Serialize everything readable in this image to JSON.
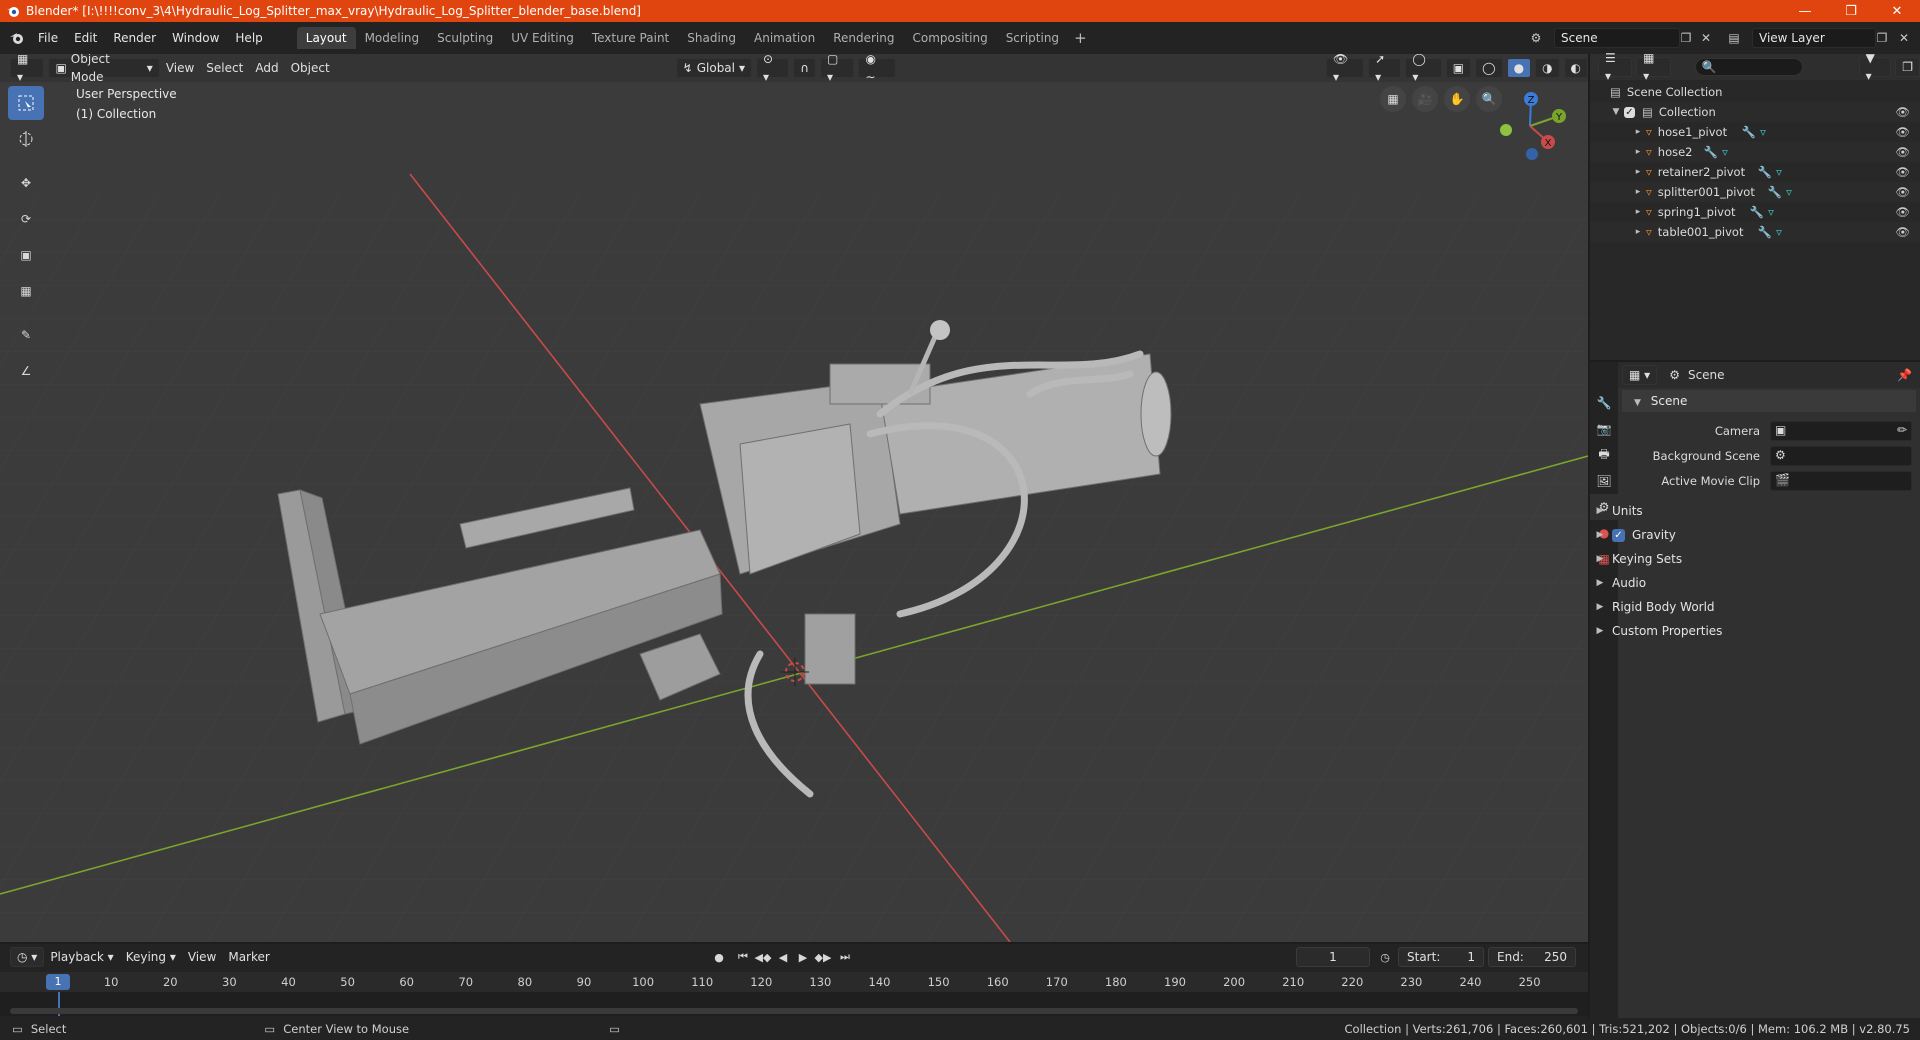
{
  "window": {
    "title": "Blender* [I:\\!!!!conv_3\\4\\Hydraulic_Log_Splitter_max_vray\\Hydraulic_Log_Splitter_blender_base.blend]",
    "accent": "#e0450f"
  },
  "menu": [
    "File",
    "Edit",
    "Render",
    "Window",
    "Help"
  ],
  "workspaces": {
    "active": "Layout",
    "tabs": [
      "Layout",
      "Modeling",
      "Sculpting",
      "UV Editing",
      "Texture Paint",
      "Shading",
      "Animation",
      "Rendering",
      "Compositing",
      "Scripting"
    ]
  },
  "topright": {
    "scene": "Scene",
    "view_layer": "View Layer"
  },
  "viewport": {
    "mode": "Object Mode",
    "menus": [
      "View",
      "Select",
      "Add",
      "Object"
    ],
    "transform_orientation": "Global",
    "info_line1": "User Perspective",
    "info_line2": "(1) Collection",
    "axes": {
      "x": "X",
      "y": "Y",
      "z": "Z"
    },
    "colors": {
      "x_axis": "#c94a4a",
      "y_axis": "#7aa52b",
      "z_axis": "#3d7bd9",
      "selection": "#4772b3"
    }
  },
  "tools": [
    "select-box",
    "cursor",
    "move",
    "rotate",
    "scale",
    "transform",
    "annotate",
    "measure"
  ],
  "outliner": {
    "root": "Scene Collection",
    "collection": "Collection",
    "objects": [
      "hose1_pivot",
      "hose2",
      "retainer2_pivot",
      "splitter001_pivot",
      "spring1_pivot",
      "table001_pivot"
    ]
  },
  "properties": {
    "header": "Scene",
    "panel": "Scene",
    "fields": [
      {
        "label": "Camera"
      },
      {
        "label": "Background Scene"
      },
      {
        "label": "Active Movie Clip"
      }
    ],
    "sections": [
      "Units",
      "Gravity",
      "Keying Sets",
      "Audio",
      "Rigid Body World",
      "Custom Properties"
    ]
  },
  "timeline": {
    "menus": [
      "Playback",
      "Keying",
      "View",
      "Marker"
    ],
    "current_frame": "1",
    "start_label": "Start:",
    "start": "1",
    "end_label": "End:",
    "end": "250",
    "ruler": [
      "1",
      "10",
      "20",
      "30",
      "40",
      "50",
      "60",
      "70",
      "80",
      "90",
      "100",
      "110",
      "120",
      "130",
      "140",
      "150",
      "160",
      "170",
      "180",
      "190",
      "200",
      "210",
      "220",
      "230",
      "240",
      "250"
    ]
  },
  "status": {
    "left": "Select",
    "middle": "Center View to Mouse",
    "right": "Collection | Verts:261,706 | Faces:260,601 | Tris:521,202 | Objects:0/6 | Mem: 106.2 MB | v2.80.75"
  }
}
